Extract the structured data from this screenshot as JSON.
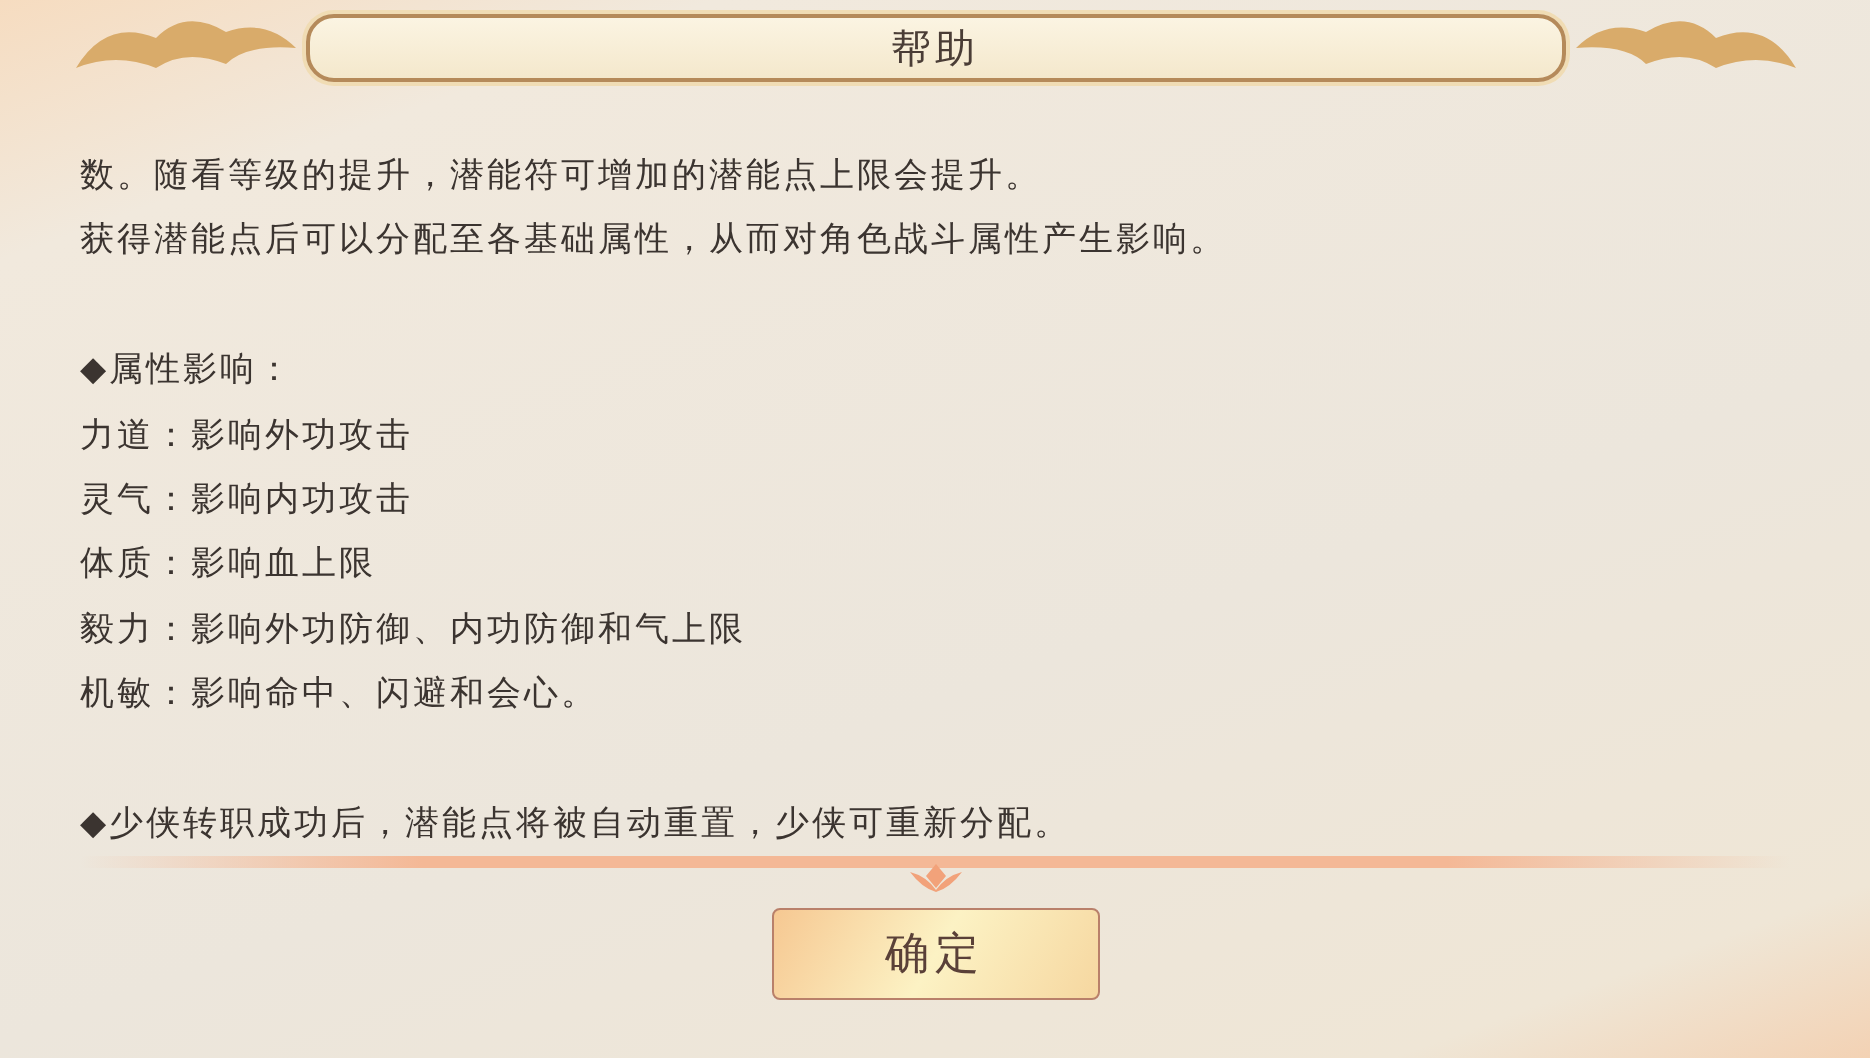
{
  "window": {
    "title": "帮助"
  },
  "paragraphs": [
    [
      "数。随看等级的提升，潜能符可增加的潜能点上限会提升。",
      "获得潜能点后可以分配至各基础属性，从而对角色战斗属性产生影响。"
    ],
    [
      "◆属性影响：",
      "力道：影响外功攻击",
      "灵气：影响内功攻击",
      "体质：影响血上限",
      "毅力：影响外功防御、内功防御和气上限",
      "机敏：影响命中、闪避和会心。"
    ],
    [
      "◆少侠转职成功后，潜能点将被自动重置，少侠可重新分配。"
    ]
  ],
  "confirm_button": "确定"
}
